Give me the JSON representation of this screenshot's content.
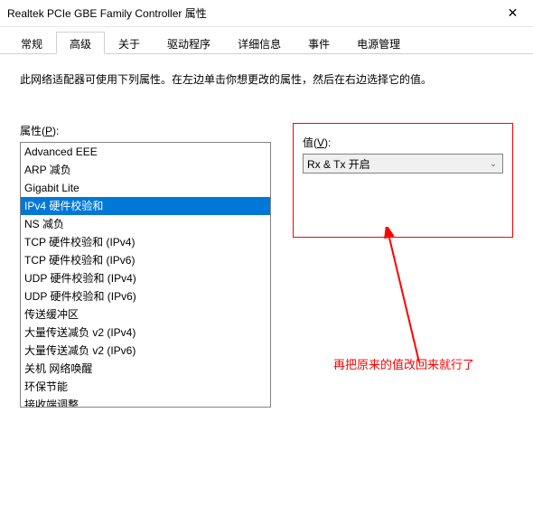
{
  "window": {
    "title": "Realtek PCIe GBE Family Controller 属性",
    "close_glyph": "✕"
  },
  "tabs": {
    "t0": "常规",
    "t1": "高级",
    "t2": "关于",
    "t3": "驱动程序",
    "t4": "详细信息",
    "t5": "事件",
    "t6": "电源管理",
    "active_index": 1
  },
  "description": "此网络适配器可使用下列属性。在左边单击你想更改的属性，然后在右边选择它的值。",
  "property_label_prefix": "属性(",
  "property_label_key": "P",
  "property_label_suffix": "):",
  "value_label_prefix": "值(",
  "value_label_key": "V",
  "value_label_suffix": "):",
  "properties": [
    "Advanced EEE",
    "ARP 减负",
    "Gigabit Lite",
    "IPv4 硬件校验和",
    "NS 减负",
    "TCP 硬件校验和 (IPv4)",
    "TCP 硬件校验和 (IPv6)",
    "UDP 硬件校验和 (IPv4)",
    "UDP 硬件校验和 (IPv6)",
    "传送缓冲区",
    "大量传送减负 v2 (IPv4)",
    "大量传送减负 v2 (IPv6)",
    "关机 网络唤醒",
    "环保节能",
    "接收端调整"
  ],
  "selected_property_index": 3,
  "current_value": "Rx & Tx 开启",
  "annotation_text": "再把原来的值改回来就行了"
}
